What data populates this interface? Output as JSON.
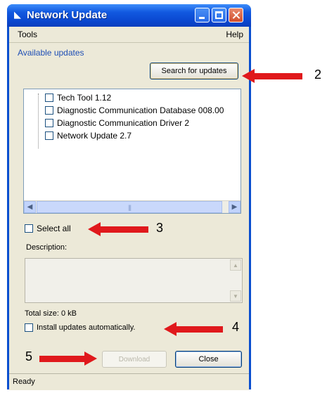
{
  "window": {
    "title": "Network Update"
  },
  "menu": {
    "tools": "Tools",
    "help": "Help"
  },
  "updates": {
    "section_label": "Available updates",
    "search_button": "Search for updates",
    "items": [
      {
        "label": "Tech Tool 1.12"
      },
      {
        "label": "Diagnostic Communication Database 008.00"
      },
      {
        "label": "Diagnostic Communication Driver 2"
      },
      {
        "label": "Network Update 2.7"
      }
    ]
  },
  "select_all_label": "Select all",
  "description_label": "Description:",
  "total_size": "Total size: 0 kB",
  "install_auto_label": "Install updates automatically.",
  "buttons": {
    "download": "Download",
    "close": "Close"
  },
  "status": "Ready",
  "callouts": {
    "search": "2",
    "select_all": "3",
    "install_auto": "4",
    "download": "5"
  },
  "colors": {
    "arrow": "#e0191c",
    "title_bar": "#0a47cf",
    "window_bg": "#ece9d8"
  }
}
